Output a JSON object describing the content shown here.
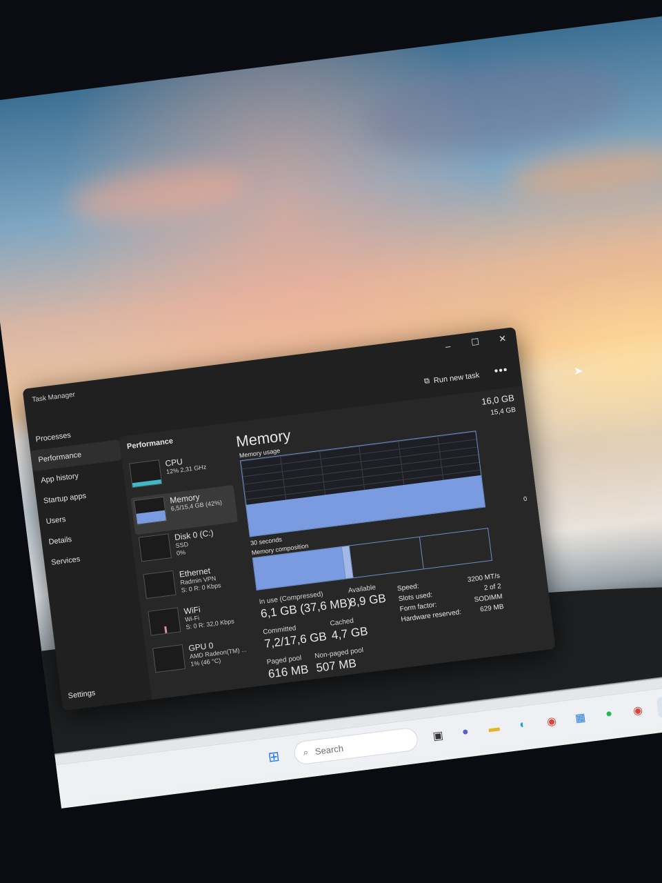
{
  "window": {
    "title": "Task Manager"
  },
  "nav": {
    "items": [
      {
        "label": "Processes"
      },
      {
        "label": "Performance"
      },
      {
        "label": "App history"
      },
      {
        "label": "Startup apps"
      },
      {
        "label": "Users"
      },
      {
        "label": "Details"
      },
      {
        "label": "Services"
      }
    ],
    "settings": "Settings"
  },
  "toolbar": {
    "run_new_task": "Run new task",
    "more": "•••"
  },
  "performance": {
    "heading": "Performance",
    "devices": [
      {
        "name": "CPU",
        "sub1": "12% 2,31 GHz",
        "sub2": "",
        "sub3": ""
      },
      {
        "name": "Memory",
        "sub1": "6,5/15,4 GB (42%)",
        "sub2": "",
        "sub3": ""
      },
      {
        "name": "Disk 0 (C:)",
        "sub1": "SSD",
        "sub2": "0%",
        "sub3": ""
      },
      {
        "name": "Ethernet",
        "sub1": "Radmin VPN",
        "sub2": "S: 0 R: 0 Kbps",
        "sub3": ""
      },
      {
        "name": "WiFi",
        "sub1": "Wi-Fi",
        "sub2": "S: 0 R: 32,0 Kbps",
        "sub3": ""
      },
      {
        "name": "GPU 0",
        "sub1": "AMD Radeon(TM) ...",
        "sub2": "1% (46 °C)",
        "sub3": ""
      }
    ]
  },
  "memory": {
    "title": "Memory",
    "total": "16,0 GB",
    "max": "15,4 GB",
    "usage_label": "Memory usage",
    "zero": "0",
    "seconds": "30 seconds",
    "composition_label": "Memory composition",
    "usage_fraction": 0.42,
    "stats": {
      "in_use_label": "In use (Compressed)",
      "in_use": "6,1 GB (37,6 MB)",
      "available_label": "Available",
      "available": "8,9 GB",
      "committed_label": "Committed",
      "committed": "7,2/17,6 GB",
      "cached_label": "Cached",
      "cached": "4,7 GB",
      "paged_label": "Paged pool",
      "paged": "616 MB",
      "nonpaged_label": "Non-paged pool",
      "nonpaged": "507 MB"
    },
    "specs": [
      {
        "label": "Speed:",
        "value": "3200 MT/s"
      },
      {
        "label": "Slots used:",
        "value": "2 of 2"
      },
      {
        "label": "Form factor:",
        "value": "SODIMM"
      },
      {
        "label": "Hardware reserved:",
        "value": "629 MB"
      }
    ]
  },
  "taskbar": {
    "search_placeholder": "Search"
  },
  "colors": {
    "accent": "#7b9be0",
    "window_bg": "#202020"
  }
}
